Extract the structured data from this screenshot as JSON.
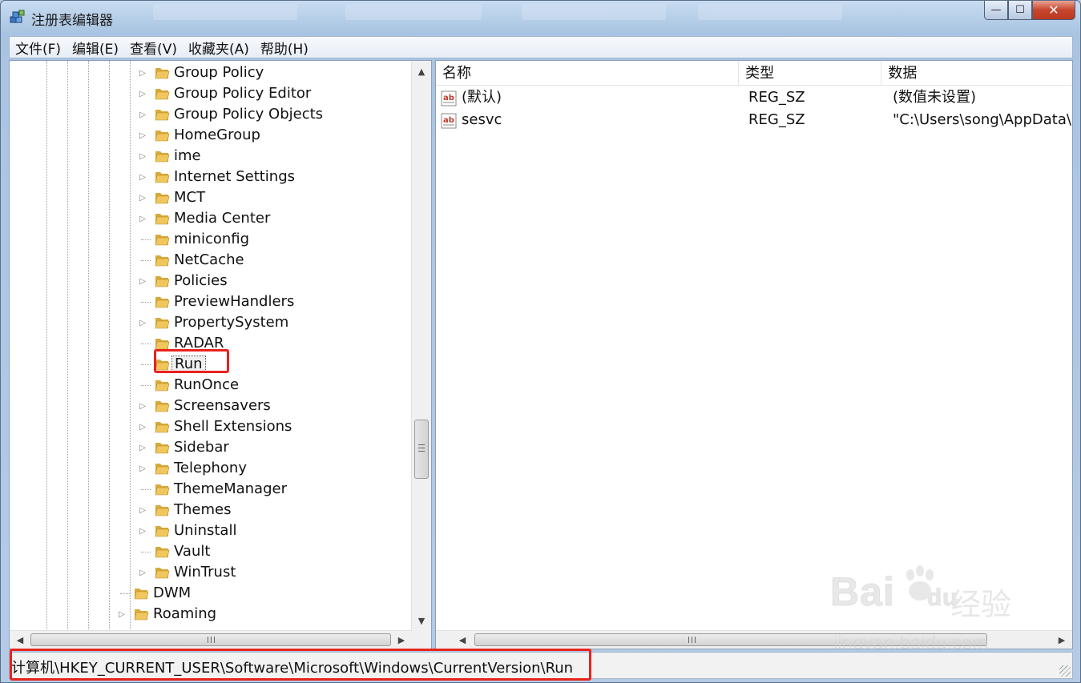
{
  "window": {
    "title": "注册表编辑器",
    "controls": {
      "minimize": "—",
      "maximize": "☐",
      "close": "✕"
    }
  },
  "menu": [
    "文件(F)",
    "编辑(E)",
    "查看(V)",
    "收藏夹(A)",
    "帮助(H)"
  ],
  "tree": {
    "nodes": [
      {
        "label": "Group Policy",
        "level": 2,
        "expandable": true
      },
      {
        "label": "Group Policy Editor",
        "level": 2,
        "expandable": true
      },
      {
        "label": "Group Policy Objects",
        "level": 2,
        "expandable": true
      },
      {
        "label": "HomeGroup",
        "level": 2,
        "expandable": true
      },
      {
        "label": "ime",
        "level": 2,
        "expandable": true
      },
      {
        "label": "Internet Settings",
        "level": 2,
        "expandable": true
      },
      {
        "label": "MCT",
        "level": 2,
        "expandable": true
      },
      {
        "label": "Media Center",
        "level": 2,
        "expandable": true
      },
      {
        "label": "miniconfig",
        "level": 2,
        "expandable": false
      },
      {
        "label": "NetCache",
        "level": 2,
        "expandable": false
      },
      {
        "label": "Policies",
        "level": 2,
        "expandable": true
      },
      {
        "label": "PreviewHandlers",
        "level": 2,
        "expandable": false
      },
      {
        "label": "PropertySystem",
        "level": 2,
        "expandable": true
      },
      {
        "label": "RADAR",
        "level": 2,
        "expandable": false
      },
      {
        "label": "Run",
        "level": 2,
        "expandable": false,
        "selected": true
      },
      {
        "label": "RunOnce",
        "level": 2,
        "expandable": false
      },
      {
        "label": "Screensavers",
        "level": 2,
        "expandable": true
      },
      {
        "label": "Shell Extensions",
        "level": 2,
        "expandable": true
      },
      {
        "label": "Sidebar",
        "level": 2,
        "expandable": true
      },
      {
        "label": "Telephony",
        "level": 2,
        "expandable": true
      },
      {
        "label": "ThemeManager",
        "level": 2,
        "expandable": false
      },
      {
        "label": "Themes",
        "level": 2,
        "expandable": true
      },
      {
        "label": "Uninstall",
        "level": 2,
        "expandable": true
      },
      {
        "label": "Vault",
        "level": 2,
        "expandable": false
      },
      {
        "label": "WinTrust",
        "level": 2,
        "expandable": true
      },
      {
        "label": "DWM",
        "level": 1,
        "expandable": false
      },
      {
        "label": "Roaming",
        "level": 1,
        "expandable": true
      }
    ]
  },
  "list": {
    "columns": [
      "名称",
      "类型",
      "数据"
    ],
    "rows": [
      {
        "name": "(默认)",
        "type": "REG_SZ",
        "data": "(数值未设置)"
      },
      {
        "name": "sesvc",
        "type": "REG_SZ",
        "data": "\"C:\\Users\\song\\AppData\\R"
      }
    ]
  },
  "status": {
    "path": "计算机\\HKEY_CURRENT_USER\\Software\\Microsoft\\Windows\\CurrentVersion\\Run"
  },
  "watermark": {
    "brand": "Bai",
    "brand2": "du",
    "cn": "经验",
    "url": "jingyan.baidu.com"
  },
  "colors": {
    "highlight": "#e8231d",
    "folder": "#f0c75e",
    "titlebar": "#b9cde4"
  }
}
